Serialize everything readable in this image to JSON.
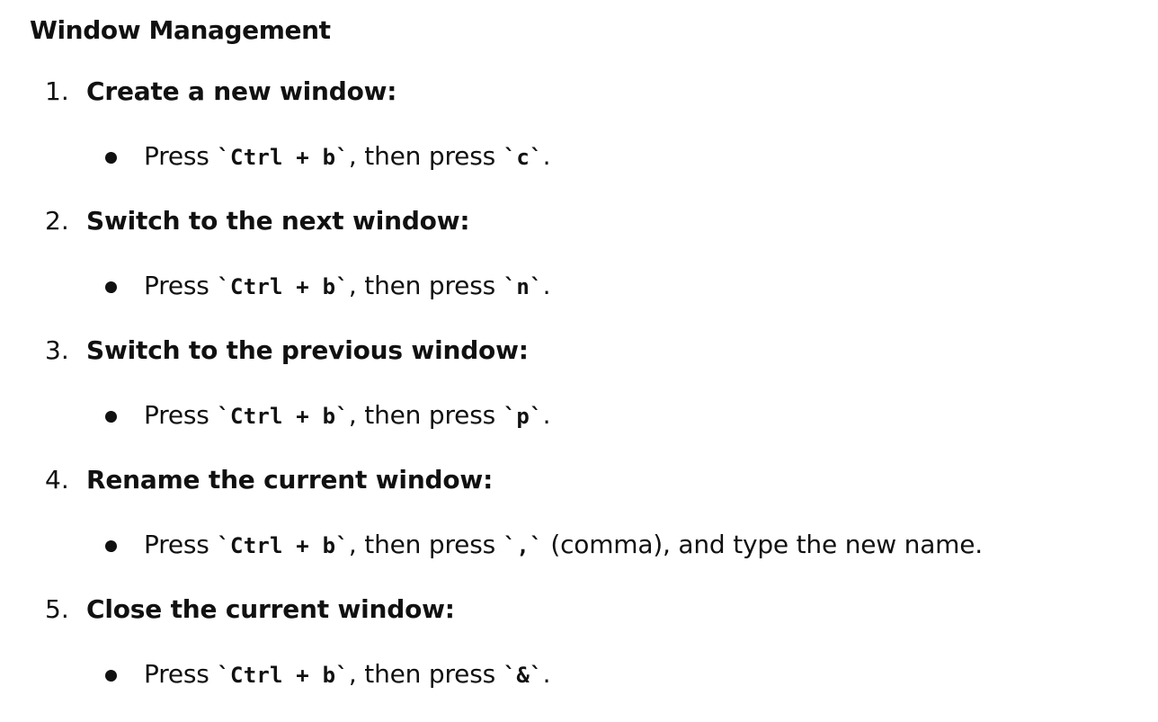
{
  "document": {
    "heading": "Window Management",
    "steps": [
      {
        "number": "1.",
        "title": "Create a new window:",
        "bullet": {
          "prefix": "Press ",
          "code1": "`Ctrl + b`",
          "middle": ", then press ",
          "code2": "`c`",
          "suffix": "."
        }
      },
      {
        "number": "2.",
        "title": "Switch to the next window:",
        "bullet": {
          "prefix": "Press ",
          "code1": "`Ctrl + b`",
          "middle": ", then press ",
          "code2": "`n`",
          "suffix": "."
        }
      },
      {
        "number": "3.",
        "title": "Switch to the previous window:",
        "bullet": {
          "prefix": "Press ",
          "code1": "`Ctrl + b`",
          "middle": ", then press ",
          "code2": "`p`",
          "suffix": "."
        }
      },
      {
        "number": "4.",
        "title": "Rename the current window:",
        "bullet": {
          "prefix": "Press ",
          "code1": "`Ctrl + b`",
          "middle": ", then press ",
          "code2": "`,`",
          "suffix": " (comma), and type the new name."
        }
      },
      {
        "number": "5.",
        "title": "Close the current window:",
        "bullet": {
          "prefix": "Press ",
          "code1": "`Ctrl + b`",
          "middle": ", then press ",
          "code2": "`&`",
          "suffix": "."
        }
      }
    ]
  }
}
